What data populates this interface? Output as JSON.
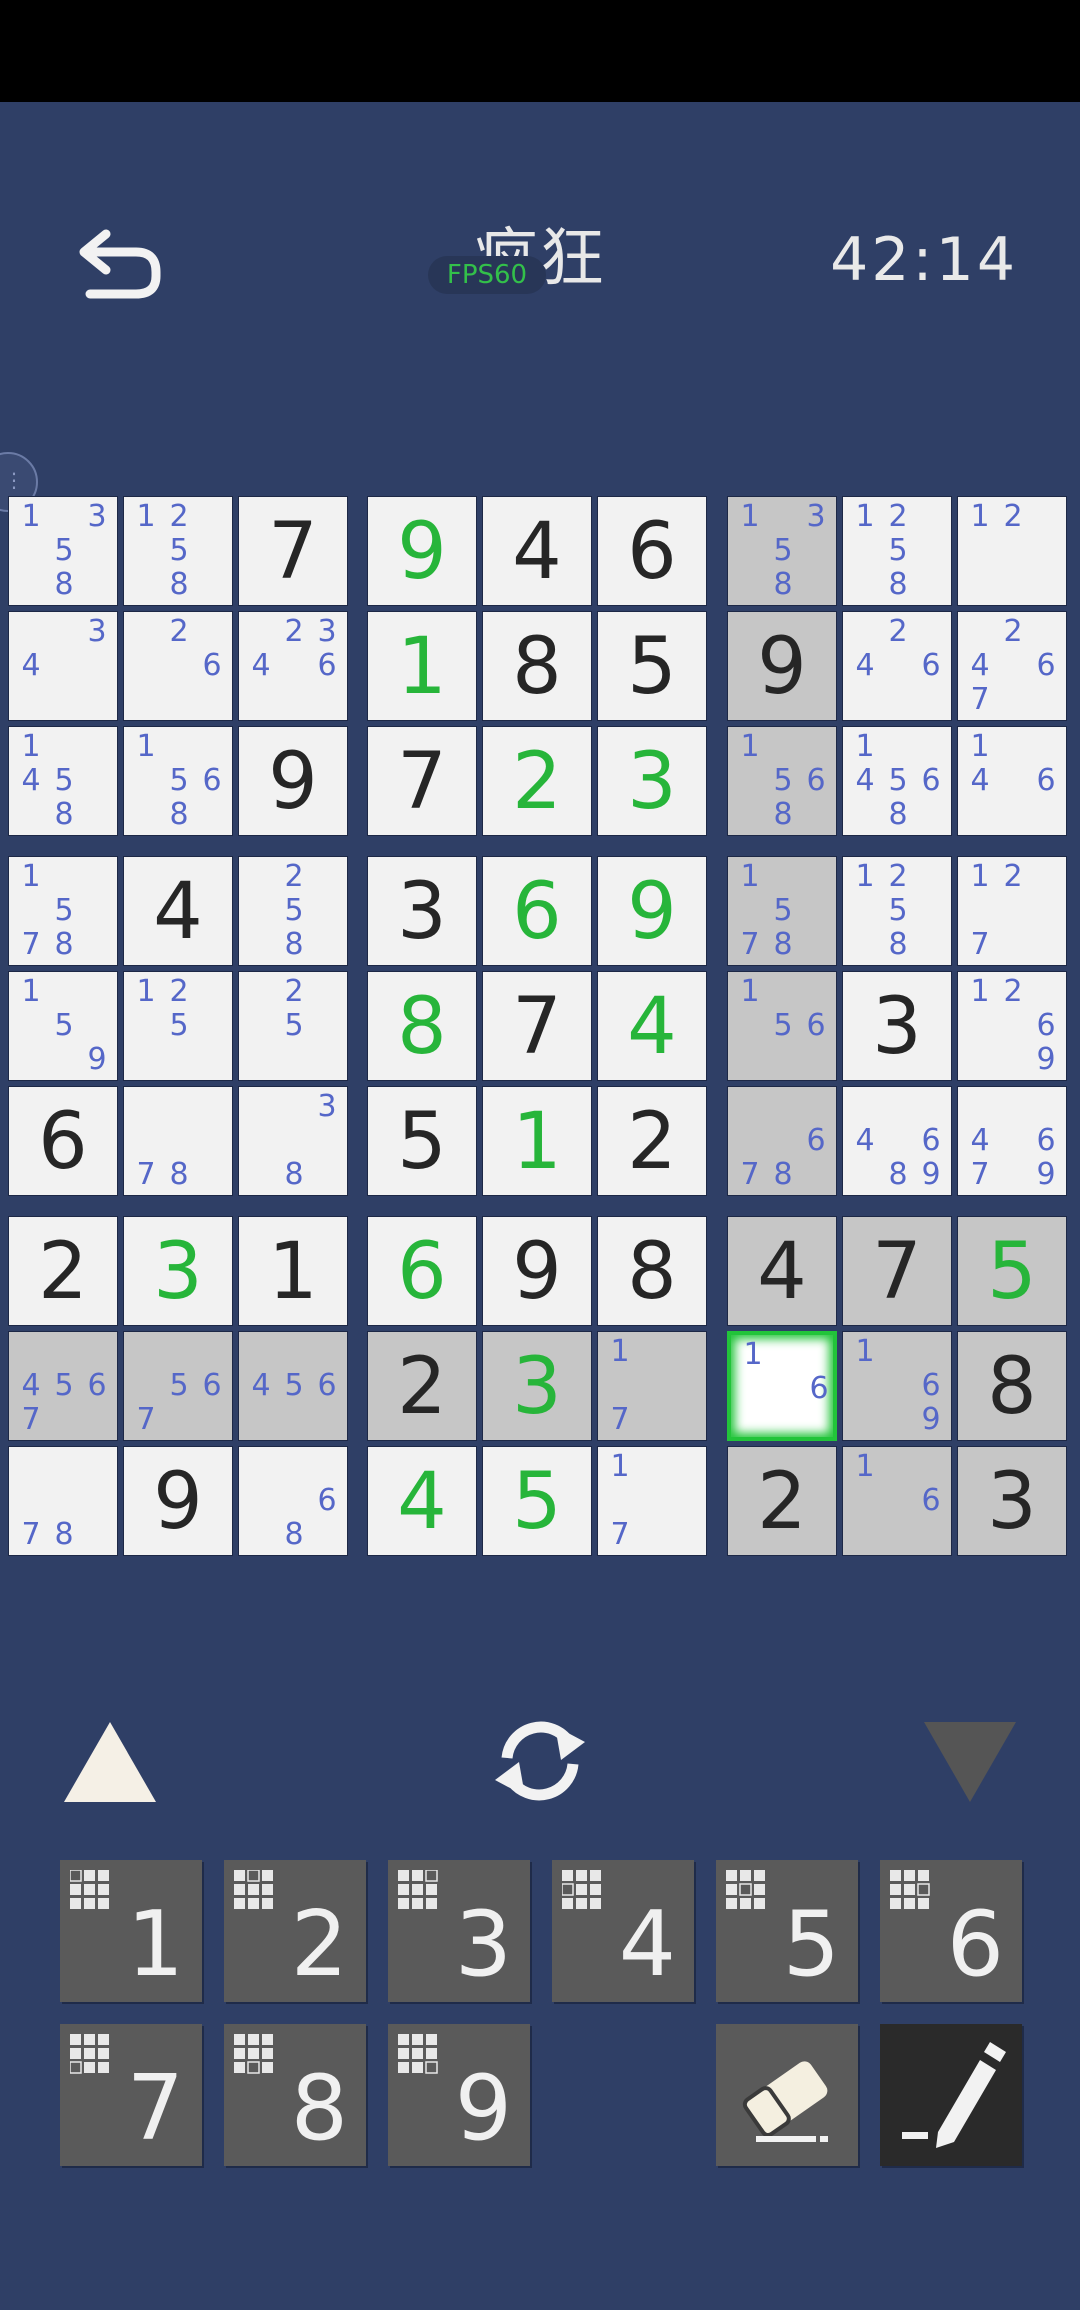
{
  "header": {
    "title": "疯狂",
    "fps": "FPS60",
    "timer": "42:14"
  },
  "board": [
    [
      {
        "n": [
          1,
          3,
          5,
          8
        ]
      },
      {
        "n": [
          1,
          2,
          5,
          8
        ]
      },
      {
        "v": 7,
        "t": "g"
      },
      {
        "v": 9,
        "t": "u"
      },
      {
        "v": 4,
        "t": "g"
      },
      {
        "v": 6,
        "t": "g"
      },
      {
        "n": [
          1,
          3,
          5,
          8
        ],
        "h": 1
      },
      {
        "n": [
          1,
          2,
          5,
          8
        ]
      },
      {
        "n": [
          1,
          2
        ]
      }
    ],
    [
      {
        "n": [
          3,
          4
        ]
      },
      {
        "n": [
          2,
          6
        ]
      },
      {
        "n": [
          2,
          3,
          4,
          6
        ]
      },
      {
        "v": 1,
        "t": "u"
      },
      {
        "v": 8,
        "t": "g"
      },
      {
        "v": 5,
        "t": "g"
      },
      {
        "v": 9,
        "t": "g",
        "h": 1
      },
      {
        "n": [
          2,
          4,
          6
        ]
      },
      {
        "n": [
          2,
          4,
          6,
          7
        ]
      }
    ],
    [
      {
        "n": [
          1,
          4,
          5,
          8
        ]
      },
      {
        "n": [
          1,
          5,
          6,
          8
        ]
      },
      {
        "v": 9,
        "t": "g"
      },
      {
        "v": 7,
        "t": "g"
      },
      {
        "v": 2,
        "t": "u"
      },
      {
        "v": 3,
        "t": "u"
      },
      {
        "n": [
          1,
          5,
          6,
          8
        ],
        "h": 1
      },
      {
        "n": [
          1,
          4,
          5,
          6,
          8
        ]
      },
      {
        "n": [
          1,
          4,
          6
        ]
      }
    ],
    [
      {
        "n": [
          1,
          5,
          7,
          8
        ]
      },
      {
        "v": 4,
        "t": "g"
      },
      {
        "n": [
          2,
          5,
          8
        ]
      },
      {
        "v": 3,
        "t": "g"
      },
      {
        "v": 6,
        "t": "u"
      },
      {
        "v": 9,
        "t": "u"
      },
      {
        "n": [
          1,
          5,
          7,
          8
        ],
        "h": 1
      },
      {
        "n": [
          1,
          2,
          5,
          8
        ]
      },
      {
        "n": [
          1,
          2,
          7
        ]
      }
    ],
    [
      {
        "n": [
          1,
          5,
          9
        ]
      },
      {
        "n": [
          1,
          2,
          5
        ]
      },
      {
        "n": [
          2,
          5
        ]
      },
      {
        "v": 8,
        "t": "u"
      },
      {
        "v": 7,
        "t": "g"
      },
      {
        "v": 4,
        "t": "u"
      },
      {
        "n": [
          1,
          5,
          6
        ],
        "h": 1
      },
      {
        "v": 3,
        "t": "g"
      },
      {
        "n": [
          1,
          2,
          6,
          9
        ]
      }
    ],
    [
      {
        "v": 6,
        "t": "g"
      },
      {
        "n": [
          7,
          8
        ]
      },
      {
        "n": [
          3,
          8
        ]
      },
      {
        "v": 5,
        "t": "g"
      },
      {
        "v": 1,
        "t": "u"
      },
      {
        "v": 2,
        "t": "g"
      },
      {
        "n": [
          6,
          7,
          8
        ],
        "h": 1
      },
      {
        "n": [
          4,
          6,
          8,
          9
        ]
      },
      {
        "n": [
          4,
          6,
          7,
          9
        ]
      }
    ],
    [
      {
        "v": 2,
        "t": "g"
      },
      {
        "v": 3,
        "t": "u"
      },
      {
        "v": 1,
        "t": "g"
      },
      {
        "v": 6,
        "t": "u"
      },
      {
        "v": 9,
        "t": "g"
      },
      {
        "v": 8,
        "t": "g"
      },
      {
        "v": 4,
        "t": "g",
        "h": 1
      },
      {
        "v": 7,
        "t": "g",
        "h": 1
      },
      {
        "v": 5,
        "t": "u",
        "h": 1
      }
    ],
    [
      {
        "n": [
          4,
          5,
          6,
          7
        ],
        "h": 1
      },
      {
        "n": [
          5,
          6,
          7
        ],
        "h": 1
      },
      {
        "n": [
          4,
          5,
          6
        ],
        "h": 1
      },
      {
        "v": 2,
        "t": "g",
        "h": 1
      },
      {
        "v": 3,
        "t": "u",
        "h": 1
      },
      {
        "n": [
          1,
          7
        ],
        "h": 1
      },
      {
        "n": [
          1,
          6
        ],
        "s": 1
      },
      {
        "n": [
          1,
          6,
          9
        ],
        "h": 1
      },
      {
        "v": 8,
        "t": "g",
        "h": 1
      }
    ],
    [
      {
        "n": [
          7,
          8
        ]
      },
      {
        "v": 9,
        "t": "g"
      },
      {
        "n": [
          6,
          8
        ]
      },
      {
        "v": 4,
        "t": "u"
      },
      {
        "v": 5,
        "t": "u"
      },
      {
        "n": [
          1,
          7
        ]
      },
      {
        "v": 2,
        "t": "g",
        "h": 1
      },
      {
        "n": [
          1,
          6
        ],
        "h": 1
      },
      {
        "v": 3,
        "t": "g",
        "h": 1
      }
    ]
  ],
  "controls": {
    "up_icon": "triangle-up-icon",
    "refresh_icon": "refresh-icon",
    "down_icon": "triangle-down-icon"
  },
  "keypad": {
    "digits": [
      "1",
      "2",
      "3",
      "4",
      "5",
      "6",
      "7",
      "8",
      "9"
    ],
    "erase_icon": "eraser-icon",
    "pencil_icon": "pencil-icon"
  },
  "colors": {
    "background": "#2f3f66",
    "user_digit": "#27b53a",
    "note": "#5567c8",
    "selected_border": "#22c43a"
  }
}
